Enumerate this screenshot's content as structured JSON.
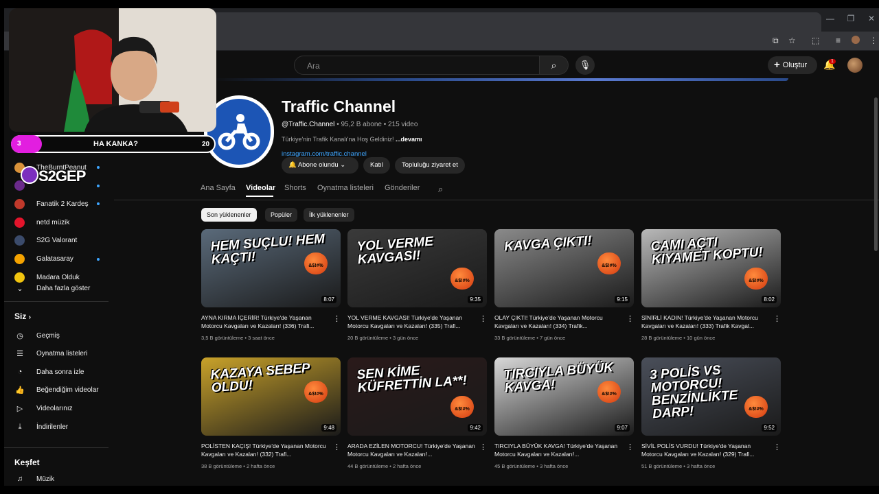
{
  "browser": {
    "window_controls": [
      "—",
      "❐",
      "✕"
    ]
  },
  "header": {
    "search_placeholder": "Ara",
    "create_label": "Oluştur",
    "notification_count": "1"
  },
  "sidebar": {
    "subscriptions_label": "kler",
    "subscriptions": [
      {
        "name": "TheBurntPeanut",
        "color": "#d9923a",
        "dot": true
      },
      {
        "name": "",
        "color": "#6a2a8a",
        "dot": true
      },
      {
        "name": "Fanatik 2 Kardeş",
        "color": "#c0392b",
        "dot": true
      },
      {
        "name": "netd müzik",
        "color": "#e3142b",
        "dot": false
      },
      {
        "name": "S2G Valorant",
        "color": "#3b4b6b",
        "dot": false
      },
      {
        "name": "Galatasaray",
        "color": "#f5a300",
        "dot": true
      },
      {
        "name": "Madara Olduk",
        "color": "#f1c40f",
        "dot": false
      }
    ],
    "show_more": "Daha fazla göster",
    "you_header": "Siz",
    "you_items": [
      {
        "icon": "history-icon",
        "label": "Geçmiş"
      },
      {
        "icon": "playlists-icon",
        "label": "Oynatma listeleri"
      },
      {
        "icon": "watch-later-icon",
        "label": "Daha sonra izle"
      },
      {
        "icon": "liked-icon",
        "label": "Beğendiğim videolar"
      },
      {
        "icon": "your-videos-icon",
        "label": "Videolarınız"
      },
      {
        "icon": "downloads-icon",
        "label": "İndirilenler"
      }
    ],
    "explore_header": "Keşfet",
    "explore_items": [
      {
        "icon": "music-icon",
        "label": "Müzik"
      }
    ]
  },
  "overlay": {
    "number": "3",
    "text": "HA KANKA?",
    "count": "20",
    "logo_text": "S2GEP"
  },
  "channel": {
    "name": "Traffic Channel",
    "handle": "@Traffic.Channel",
    "subs": "95,2 B abone",
    "videos": "215 video",
    "description": "Türkiye'nin Trafik Kanalı'na Hoş Geldiniz!",
    "more": "...devamı",
    "link": "instagram.com/traffic.channel",
    "subscribed_label": "Abone olundu",
    "join_label": "Katıl",
    "community_label": "Topluluğu ziyaret et"
  },
  "tabs": [
    "Ana Sayfa",
    "Videolar",
    "Shorts",
    "Oynatma listeleri",
    "Gönderiler"
  ],
  "active_tab": "Videolar",
  "chips": [
    "Son yüklenenler",
    "Popüler",
    "İlk yüklenenler"
  ],
  "videos": [
    {
      "thumb_text": "HEM SUÇLU! HEM KAÇTI!",
      "duration": "8:07",
      "title": "AYNA KIRMA İÇERİR! Türkiye'de Yaşanan Motorcu Kavgaları ve Kazaları! (336) Trafi...",
      "views": "3,5 B görüntüleme",
      "age": "3 saat önce",
      "bg": "#5a6a7a"
    },
    {
      "thumb_text": "YOL VERME KAVGASI!",
      "duration": "9:35",
      "title": "YOL VERME KAVGASI! Türkiye'de Yaşanan Motorcu Kavgaları ve Kazaları! (335) Trafi...",
      "views": "20 B görüntüleme",
      "age": "3 gün önce",
      "bg": "#3a3a3a"
    },
    {
      "thumb_text": "KAVGA ÇIKTI!",
      "duration": "9:15",
      "title": "OLAY ÇIKTI! Türkiye'de Yaşanan Motorcu Kavgaları ve Kazaları! (334) Trafik...",
      "views": "33 B görüntüleme",
      "age": "7 gün önce",
      "bg": "#8a8a8a"
    },
    {
      "thumb_text": "CAMI AÇTI KIYAMET KOPTU!",
      "duration": "8:02",
      "title": "SİNİRLİ KADIN! Türkiye'de Yaşanan Motorcu Kavgaları ve Kazaları! (333) Trafik Kavgal...",
      "views": "28 B görüntüleme",
      "age": "10 gün önce",
      "bg": "#b8b8b8"
    },
    {
      "thumb_text": "KAZAYA SEBEP OLDU!",
      "duration": "9:48",
      "title": "POLİSTEN KAÇIŞ! Türkiye'de Yaşanan Motorcu Kavgaları ve Kazaları! (332) Trafi...",
      "views": "38 B görüntüleme",
      "age": "2 hafta önce",
      "bg": "#c9a22a"
    },
    {
      "thumb_text": "SEN KİME KÜFRETTİN LA**!",
      "duration": "9:42",
      "title": "ARADA EZİLEN MOTORCU! Türkiye'de Yaşanan Motorcu Kavgaları ve Kazaları!...",
      "views": "44 B görüntüleme",
      "age": "2 hafta önce",
      "bg": "#2a1a1a"
    },
    {
      "thumb_text": "TIRCIYLA BÜYÜK KAVGA!",
      "duration": "9:07",
      "title": "TIRCIYLA BÜYÜK KAVGA! Türkiye'de Yaşanan Motorcu Kavgaları ve Kazaları!...",
      "views": "45 B görüntüleme",
      "age": "3 hafta önce",
      "bg": "#d8d8d8"
    },
    {
      "thumb_text": "3 POLİS VS MOTORCU! BENZİNLİKTE DARP!",
      "duration": "9:52",
      "title": "SİVİL POLİS VURDU! Türkiye'de Yaşanan Motorcu Kavgaları ve Kazaları! (329) Trafi...",
      "views": "51 B görüntüleme",
      "age": "3 hafta önce",
      "bg": "#4a4f5a"
    }
  ],
  "emoji_text": "&$!#%"
}
